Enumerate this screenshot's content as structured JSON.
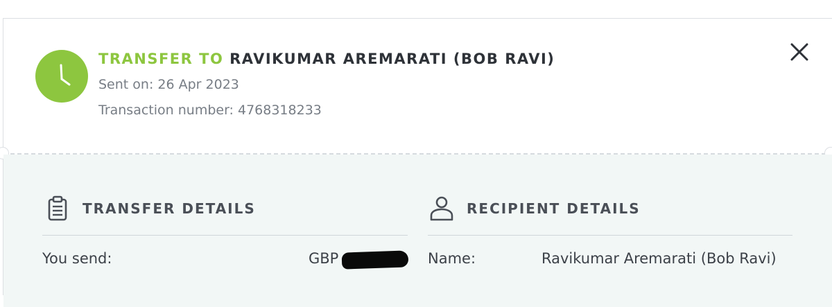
{
  "header": {
    "title_prefix": "TRANSFER TO",
    "title_name": "RAVIKUMAR AREMARATI (BOB RAVI)",
    "sent_on": "Sent on: 26 Apr 2023",
    "transaction_number": "Transaction number: 4768318233",
    "status_icon": "clock-icon",
    "accent_color": "#8dc63f"
  },
  "transfer_details": {
    "title": "TRANSFER DETAILS",
    "icon": "clipboard-icon",
    "rows": [
      {
        "label": "You send:",
        "value": "GBP"
      }
    ]
  },
  "recipient_details": {
    "title": "RECIPIENT DETAILS",
    "icon": "person-icon",
    "rows": [
      {
        "label": "Name:",
        "value": "Ravikumar Aremarati (Bob Ravi)"
      }
    ]
  }
}
